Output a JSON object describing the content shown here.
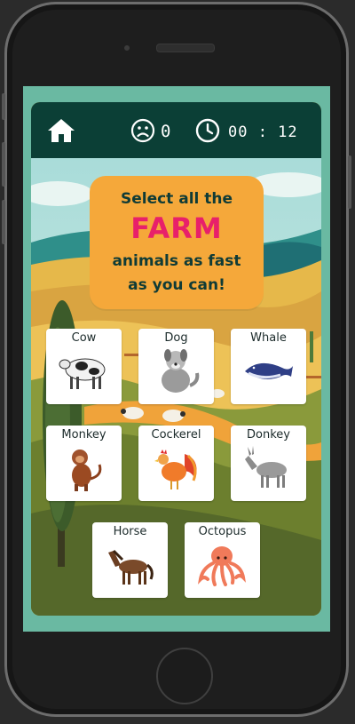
{
  "header": {
    "score": "0",
    "timer": "00 : 12",
    "icons": [
      "home-icon",
      "sad-face-icon",
      "clock-icon"
    ]
  },
  "instructions": {
    "line1": "Select all the",
    "highlight": "FARM",
    "line3": "animals as fast",
    "line4": "as you can!"
  },
  "animals": [
    {
      "name": "Cow"
    },
    {
      "name": "Dog"
    },
    {
      "name": "Whale"
    },
    {
      "name": "Monkey"
    },
    {
      "name": "Cockerel"
    },
    {
      "name": "Donkey"
    },
    {
      "name": "Horse"
    },
    {
      "name": "Octopus"
    }
  ],
  "colors": {
    "header_bg": "#0b3f36",
    "screen_bg": "#6ab9a2",
    "banner_bg": "#f5a83a",
    "highlight": "#e8206a"
  }
}
